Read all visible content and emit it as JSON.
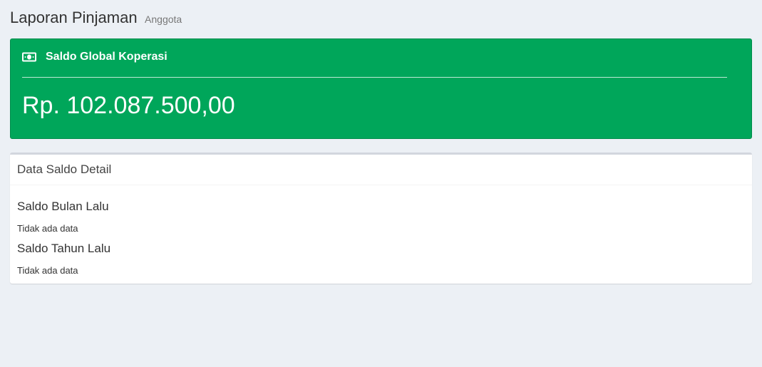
{
  "header": {
    "title": "Laporan Pinjaman",
    "subtitle": "Anggota"
  },
  "saldo_global": {
    "icon": "money-icon",
    "label": "Saldo Global Koperasi",
    "amount": "Rp. 102.087.500,00",
    "color": "#00a65a"
  },
  "detail": {
    "title": "Data Saldo Detail",
    "sections": [
      {
        "heading": "Saldo Bulan Lalu",
        "empty_text": "Tidak ada data"
      },
      {
        "heading": "Saldo Tahun Lalu",
        "empty_text": "Tidak ada data"
      }
    ]
  }
}
